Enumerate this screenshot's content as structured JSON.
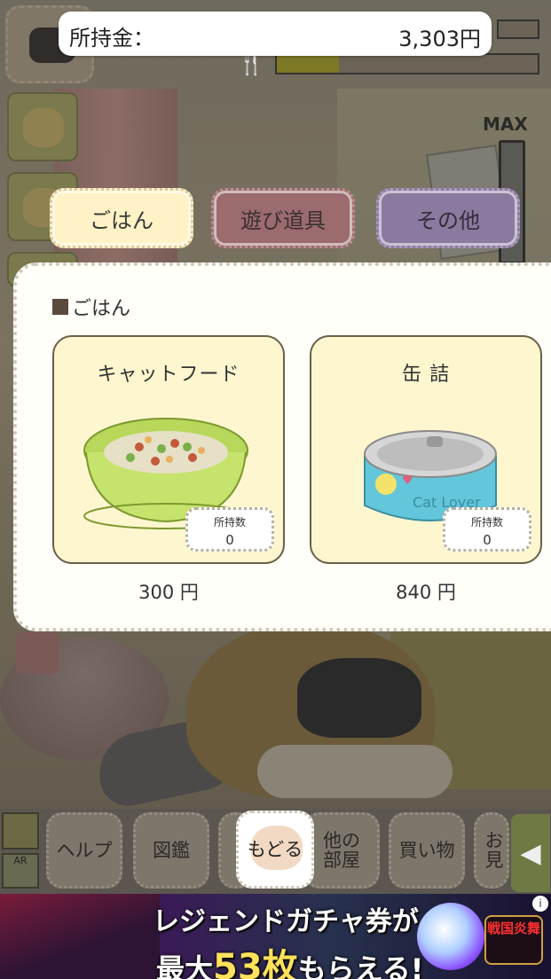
{
  "status": {
    "money_label": "所持金：",
    "money_value": "3,303円",
    "gauge_label": "MAX"
  },
  "tabs": [
    {
      "label": "ごはん",
      "selected": true
    },
    {
      "label": "遊び道具",
      "selected": false
    },
    {
      "label": "その他",
      "selected": false
    }
  ],
  "shop": {
    "section_title": "ごはん",
    "items": [
      {
        "name": "キャットフード",
        "owned_label": "所持数",
        "owned_count": "0",
        "price": "300 円",
        "icon": "cat-food-bowl"
      },
      {
        "name": "缶 詰",
        "owned_label": "所持数",
        "owned_count": "0",
        "price": "840 円",
        "icon": "cat-food-can"
      }
    ],
    "can_text": "Cat Lover"
  },
  "bottom_menu": {
    "help": "ヘルプ",
    "encyclopedia": "図鑑",
    "back": "もどる",
    "other_room_line1": "他の",
    "other_room_line2": "部屋",
    "shopping": "買い物",
    "partial": "お見",
    "ar_label": "AR"
  },
  "ad": {
    "line1": "レジェンドガチャ券が",
    "line2_pre": "最大",
    "line2_num": "53枚",
    "line2_post": "もらえる!",
    "logo": "戦国炎舞",
    "info": "i"
  },
  "colors": {
    "tab_food": "#fff2c6",
    "tab_toy": "#9c6b6e",
    "tab_other": "#8b7aa0",
    "card_bg": "#fdf6cf",
    "bowl_green": "#c6e36e",
    "can_blue": "#63c6da"
  }
}
